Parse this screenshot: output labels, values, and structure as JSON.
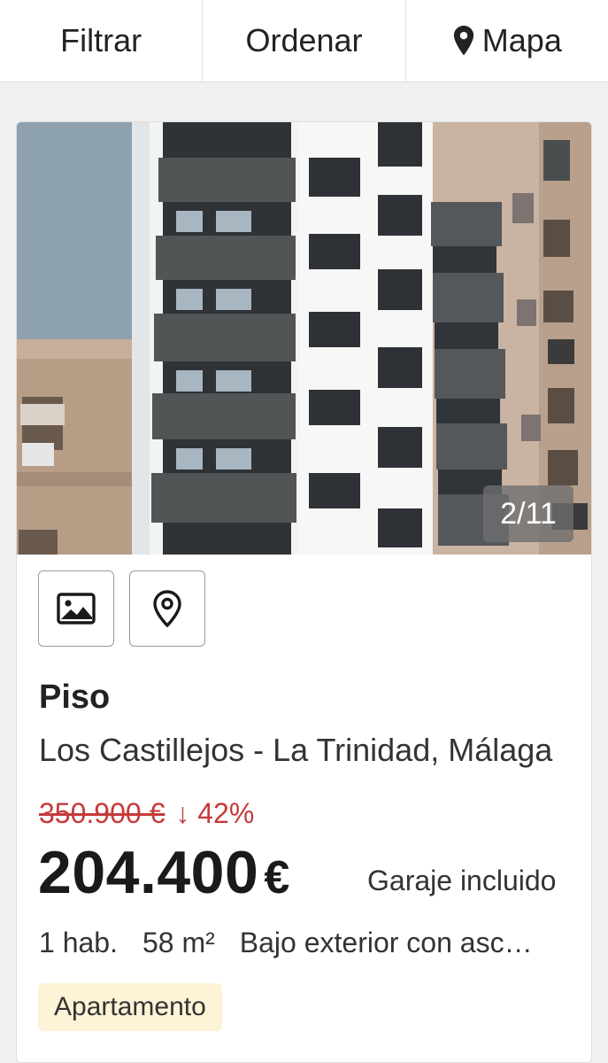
{
  "toolbar": {
    "filter_label": "Filtrar",
    "sort_label": "Ordenar",
    "map_label": "Mapa",
    "map_icon": "map-pin-icon"
  },
  "listing": {
    "photo_counter": "2/11",
    "actions": [
      {
        "icon": "image-icon"
      },
      {
        "icon": "location-pin-icon"
      }
    ],
    "type": "Piso",
    "address": "Los Castillejos - La Trinidad, Málaga",
    "old_price": "350.900 €",
    "price_drop": "↓ 42%",
    "price": "204.400",
    "currency": "€",
    "parking": "Garaje incluido",
    "rooms": "1 hab.",
    "area": "58 m²",
    "description": "Bajo exterior con ascensor",
    "tag": "Apartamento"
  },
  "colors": {
    "price_drop": "#c63a3a",
    "tag_background": "#fdf3d6",
    "page_background": "#f0f0f0"
  }
}
